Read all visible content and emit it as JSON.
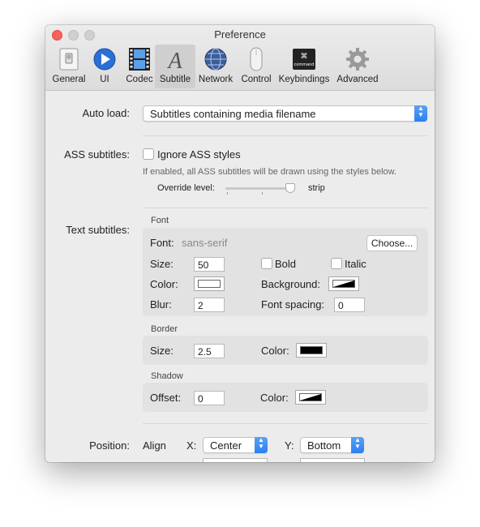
{
  "window": {
    "title": "Preference"
  },
  "toolbar": {
    "tabs": [
      {
        "label": "General",
        "icon": "switch-icon"
      },
      {
        "label": "UI",
        "icon": "play-icon"
      },
      {
        "label": "Codec",
        "icon": "film-icon"
      },
      {
        "label": "Subtitle",
        "icon": "subtitle-icon"
      },
      {
        "label": "Network",
        "icon": "globe-icon"
      },
      {
        "label": "Control",
        "icon": "mouse-icon"
      },
      {
        "label": "Keybindings",
        "icon": "command-key-icon"
      },
      {
        "label": "Advanced",
        "icon": "gear-icon"
      }
    ],
    "selected": "Subtitle",
    "command_key_text": "command"
  },
  "auto_load": {
    "label": "Auto load:",
    "value": "Subtitles containing media filename"
  },
  "ass": {
    "label": "ASS subtitles:",
    "ignore_label": "Ignore ASS styles",
    "ignore_checked": false,
    "hint": "If enabled, all ASS subtitles will be drawn using the styles below.",
    "override_label": "Override level:",
    "override_value_label": "strip",
    "override_level": 1.0
  },
  "text_subtitles": {
    "label": "Text subtitles:",
    "font_heading": "Font",
    "font_label": "Font:",
    "font_value": "sans-serif",
    "choose_button": "Choose...",
    "size_label": "Size:",
    "size_value": "50",
    "bold_label": "Bold",
    "italic_label": "Italic",
    "color_label": "Color:",
    "background_label": "Background:",
    "blur_label": "Blur:",
    "blur_value": "2",
    "spacing_label": "Font spacing:",
    "spacing_value": "0",
    "border_heading": "Border",
    "border_size_label": "Size:",
    "border_size_value": "2.5",
    "border_color_label": "Color:",
    "shadow_heading": "Shadow",
    "shadow_offset_label": "Offset:",
    "shadow_offset_value": "0",
    "shadow_color_label": "Color:"
  },
  "colors": {
    "text_color": "#ffffff",
    "border_color": "#000000",
    "accent": "#2a7ff0"
  },
  "position": {
    "label": "Position:",
    "align_label": "Align",
    "x_label": "X:",
    "x_value": "Center",
    "y_label": "Y:",
    "y_value": "Bottom"
  }
}
